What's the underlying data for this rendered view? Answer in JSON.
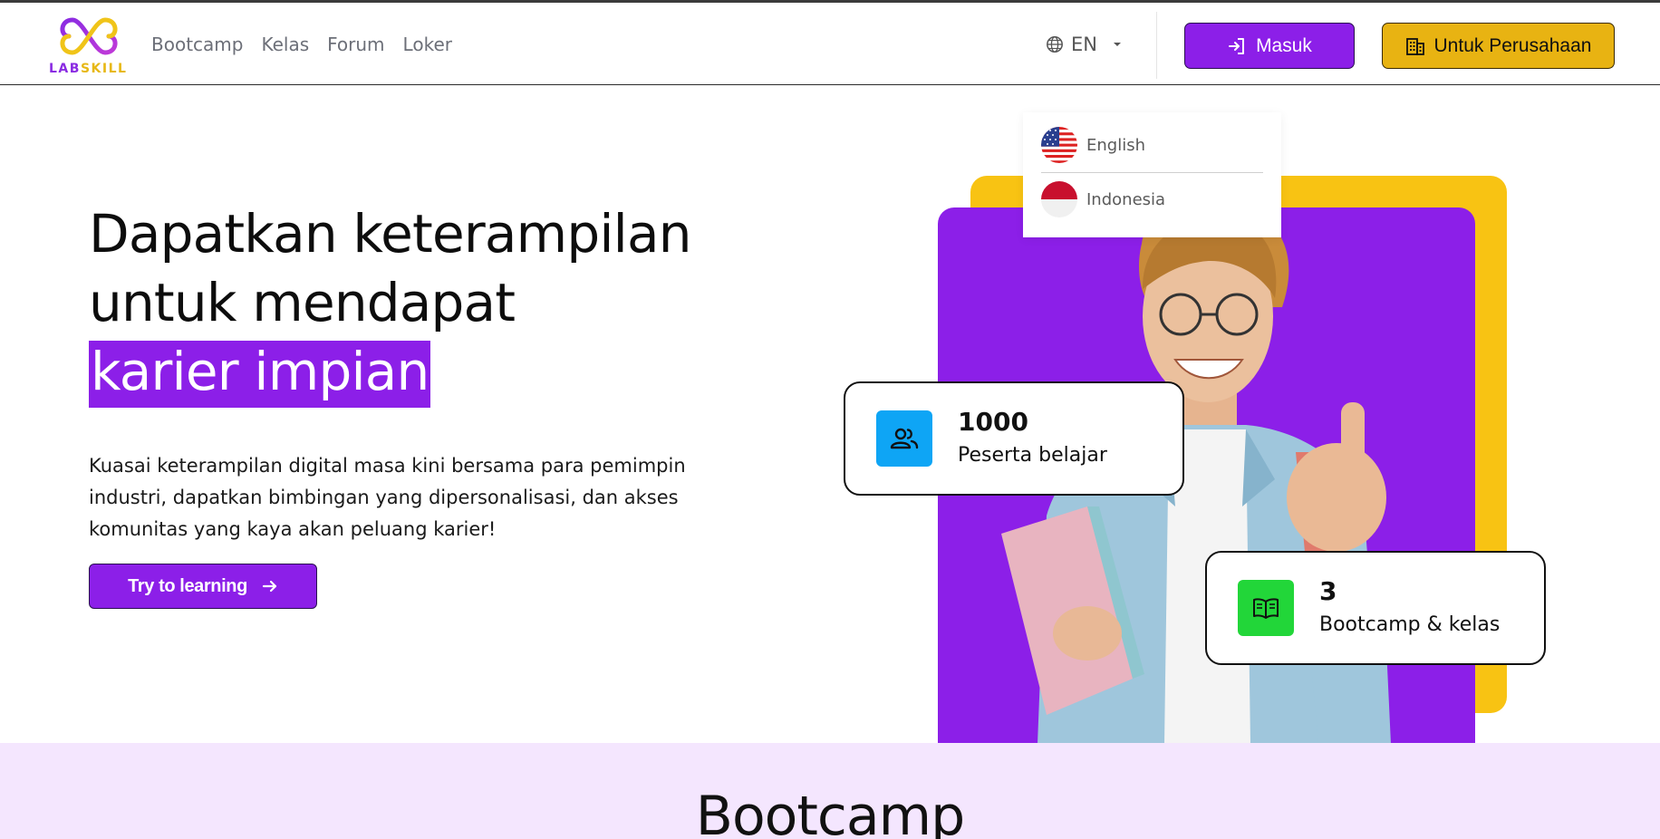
{
  "brand": {
    "logo_lab": "LAB",
    "logo_skill": "SKILL"
  },
  "nav": {
    "items": [
      "Bootcamp",
      "Kelas",
      "Forum",
      "Loker"
    ]
  },
  "language": {
    "current": "EN",
    "options": [
      "English",
      "Indonesia"
    ]
  },
  "header": {
    "login_label": "Masuk",
    "company_label": "Untuk Perusahaan"
  },
  "hero": {
    "title_line1": "Dapatkan keterampilan",
    "title_line2": "untuk mendapat",
    "title_highlight": "karier impian",
    "description": "Kuasai keterampilan digital masa kini bersama para pemimpin industri, dapatkan bimbingan yang dipersonalisasi, dan akses komunitas yang kaya akan peluang karier!",
    "cta_label": "Try to learning"
  },
  "stats": [
    {
      "value": "1000",
      "label": "Peserta belajar",
      "icon": "users-icon",
      "color": "#0ea5f5"
    },
    {
      "value": "3",
      "label": "Bootcamp & kelas",
      "icon": "book-icon",
      "color": "#22d639"
    }
  ],
  "section": {
    "title": "Bootcamp"
  },
  "colors": {
    "primary": "#8c1fe8",
    "accent": "#e8b312",
    "section_bg": "#f4e6fe"
  }
}
